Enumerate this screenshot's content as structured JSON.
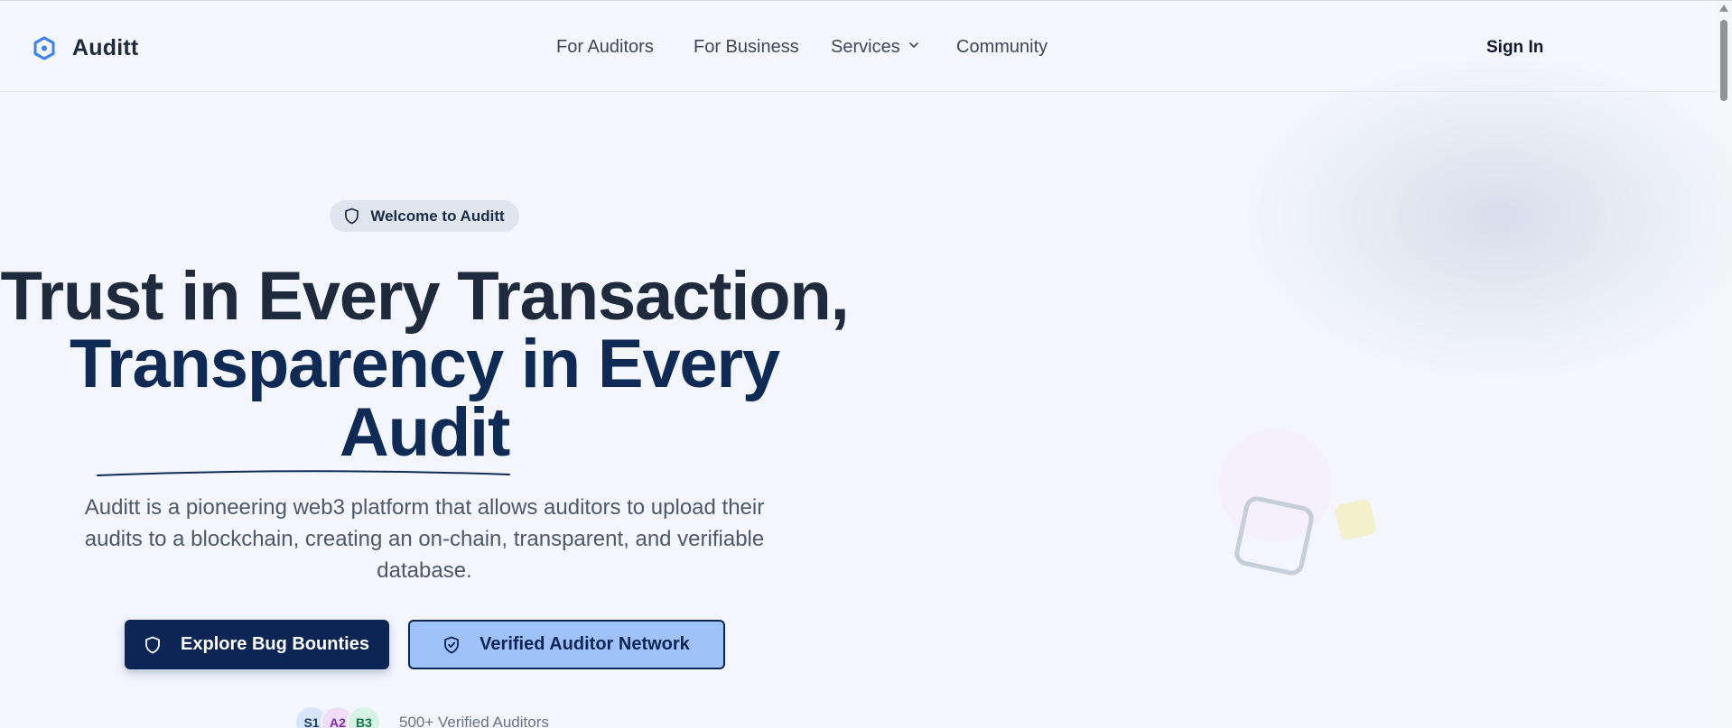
{
  "brand": {
    "name": "Auditt"
  },
  "nav": {
    "items": [
      {
        "label": "For Auditors"
      },
      {
        "label": "For Business"
      },
      {
        "label": "Services"
      },
      {
        "label": "Community"
      }
    ],
    "sign_in": "Sign In",
    "get_started": "Get Started"
  },
  "hero": {
    "badge": "Welcome to Auditt",
    "title_line1": "Trust in Every Transaction,",
    "title_line2": "Transparency in Every",
    "title_line3": "Audit",
    "description": "Auditt is a pioneering web3 platform that allows auditors to upload their audits to a blockchain, creating an on-chain, transparent, and verifiable database.",
    "primary_button": "Explore Bug Bounties",
    "secondary_button": "Verified Auditor Network",
    "avatars": [
      "S1",
      "A2",
      "B3"
    ],
    "stat": "500+ Verified Auditors"
  },
  "colors": {
    "primary": "#0d2554",
    "secondary_bg": "#9ec2f9",
    "background": "#f3f6fd",
    "logo_blue": "#3b82f6"
  },
  "icons": {
    "logo": "hexagon-logo-icon",
    "services": "chevron-down-icon",
    "badge": "shield-icon",
    "primary_button": "shield-icon",
    "secondary_button": "shield-check-icon"
  }
}
